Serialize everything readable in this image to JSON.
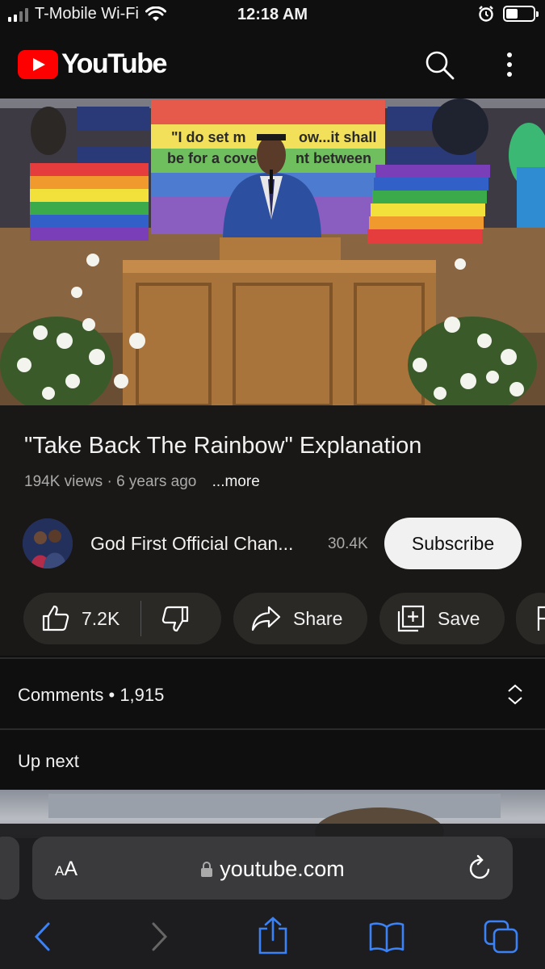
{
  "status_bar": {
    "carrier": "T-Mobile Wi-Fi",
    "time": "12:18 AM",
    "battery_level": 0.45
  },
  "header": {
    "logo_text": "YouTube",
    "brand_color": "#ff0000",
    "icons": [
      "search-icon",
      "more-vertical-icon"
    ]
  },
  "video": {
    "slide_line1": "\"I do set m",
    "slide_line1b": "ow...it shall",
    "slide_line2": "be for a cove",
    "slide_line2b": "nt between"
  },
  "info": {
    "title": "\"Take Back The Rainbow\" Explanation",
    "views": "194K views",
    "age": "6 years ago",
    "more": "...more",
    "channel_name": "God First Official Chan...",
    "subscriber_count": "30.4K",
    "subscribe_label": "Subscribe",
    "like_count": "7.2K",
    "share_label": "Share",
    "save_label": "Save"
  },
  "comments": {
    "label": "Comments",
    "count": "1,915"
  },
  "up_next": {
    "label": "Up next"
  },
  "browser": {
    "aa_label": "A",
    "aa_label_small": "A",
    "url": "youtube.com",
    "icons": [
      "lock-icon",
      "reload-icon",
      "back-icon",
      "forward-icon",
      "share-icon",
      "bookmarks-icon",
      "tabs-icon"
    ]
  }
}
